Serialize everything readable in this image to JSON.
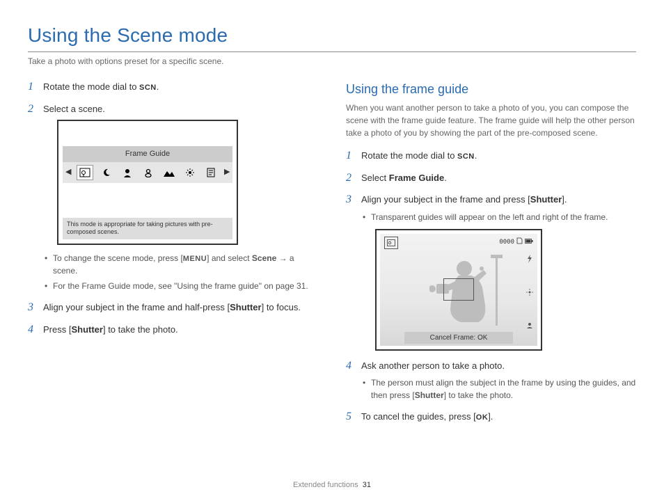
{
  "title": "Using the Scene mode",
  "subtitle": "Take a photo with options preset for a specific scene.",
  "left": {
    "step1_pre": "Rotate the mode dial to ",
    "step1_hw": "SCN",
    "step1_post": ".",
    "step2": "Select a scene.",
    "lcd_label": "Frame Guide",
    "lcd_note": "This mode is appropriate for taking pictures with pre-composed scenes.",
    "sub1_a": "To change the scene mode, press [",
    "sub1_hw": "MENU",
    "sub1_b": "] and select ",
    "sub1_bold": "Scene",
    "sub1_c": " → a scene.",
    "sub2": "For the Frame Guide mode, see \"Using the frame guide\" on page 31.",
    "step3_a": "Align your subject in the frame and half-press [",
    "step3_hw": "Shutter",
    "step3_b": "] to focus.",
    "step4_a": "Press [",
    "step4_hw": "Shutter",
    "step4_b": "] to take the photo."
  },
  "right": {
    "h2": "Using the frame guide",
    "intro": "When you want another person to take a photo of you, you can compose the scene with the frame guide feature. The frame guide will help the other person take a photo of you by showing the part of the pre-composed scene.",
    "step1_pre": "Rotate the mode dial to ",
    "step1_hw": "SCN",
    "step1_post": ".",
    "step2_a": "Select ",
    "step2_bold": "Frame Guide",
    "step2_b": ".",
    "step3_a": "Align your subject in the frame and press [",
    "step3_hw": "Shutter",
    "step3_b": "].",
    "step3_sub": "Transparent guides will appear on the left and right of the frame.",
    "lcd_counter": "0000",
    "lcd_cancel": "Cancel Frame: OK",
    "step4": "Ask another person to take a photo.",
    "step4_sub_a": "The person must align the subject in the frame by using the guides, and then press [",
    "step4_sub_hw": "Shutter",
    "step4_sub_b": "] to take the photo.",
    "step5_a": "To cancel the guides, press [",
    "step5_hw": "OK",
    "step5_b": "]."
  },
  "footer": {
    "section": "Extended functions",
    "page": "31"
  },
  "icons": {
    "frame_guide": "frame-guide-icon",
    "night": "night-icon",
    "portrait": "portrait-icon",
    "children": "children-icon",
    "landscape": "landscape-icon",
    "closeup": "closeup-icon",
    "text": "text-icon"
  }
}
